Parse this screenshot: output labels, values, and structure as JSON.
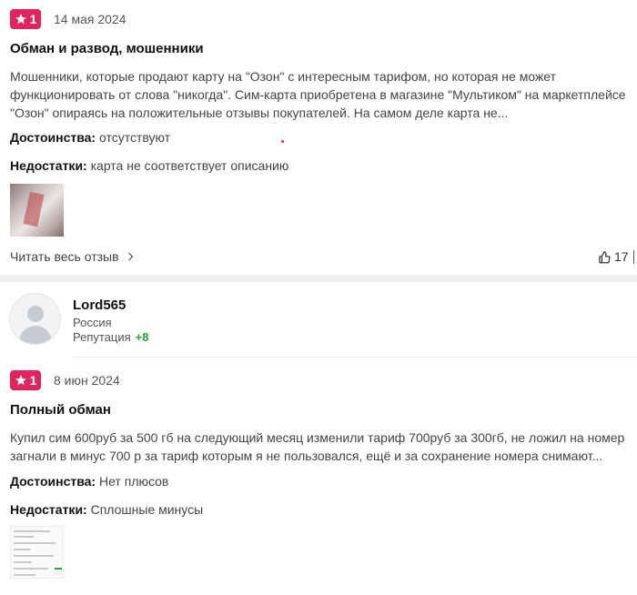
{
  "reviews": [
    {
      "rating": "1",
      "date": "14 мая 2024",
      "title": "Обман и развод, мошенники",
      "text": "Мошенники, которые продают карту на \"Озон\" с интересным тарифом, но которая не может функционировать от слова \"никогда\". Сим-карта приобретена в магазине \"Мультиком\" на маркетплейсе \"Озон\" опираясь на положительные отзывы покупателей. На самом деле карта не...",
      "pros_label": "Достоинства:",
      "pros": "отсутствуют",
      "cons_label": "Недостатки:",
      "cons": "карта не соответствует описанию",
      "read_all": "Читать весь отзыв",
      "likes": "17"
    },
    {
      "rating": "1",
      "date": "8 июн 2024",
      "title": "Полный обман",
      "text": "Купил сим 600руб за 500 гб на следующий месяц изменили тариф 700руб за 300гб, не ложил на номер загнали в минус 700 р за тариф которым я не пользовался, ещё и за сохранение номера снимают...",
      "pros_label": "Достоинства:",
      "pros": "Нет плюсов",
      "cons_label": "Недостатки:",
      "cons": "Сплошные минусы"
    }
  ],
  "author": {
    "name": "Lord565",
    "country": "Россия",
    "reputation_label": "Репутация",
    "reputation_value": "+8"
  },
  "colors": {
    "rating_badge": "#e0245e",
    "reputation_positive": "#2a9d2f"
  },
  "icons": {
    "star": "star-icon",
    "like": "thumbs-up-icon",
    "chevron": "chevron-right-icon",
    "avatar": "user-avatar-placeholder"
  }
}
